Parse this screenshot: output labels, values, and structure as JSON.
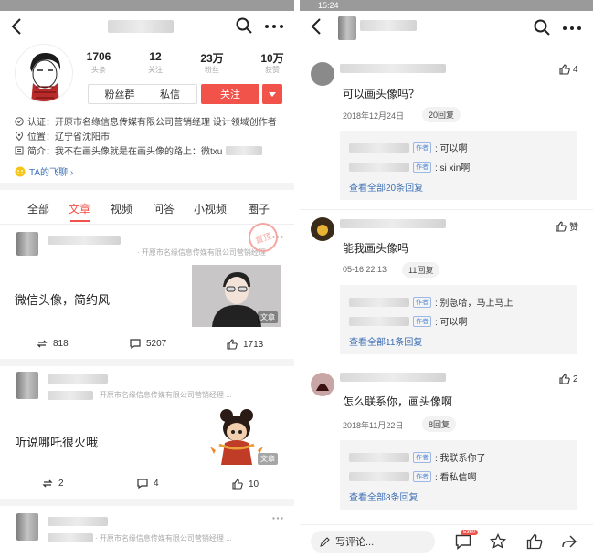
{
  "left": {
    "stats": [
      {
        "value": "1706",
        "label": "头条"
      },
      {
        "value": "12",
        "label": "关注"
      },
      {
        "value": "23万",
        "label": "粉丝"
      },
      {
        "value": "10万",
        "label": "获赞"
      }
    ],
    "buttons": {
      "fans_group": "粉丝群",
      "message": "私信",
      "follow": "关注"
    },
    "info": {
      "certified": "认证：开原市名缘信息传媒有限公司营销经理 设计领域创作者",
      "location": "位置：辽宁省沈阳市",
      "bio": "简介：我不在画头像就是在画头像的路上：微txu"
    },
    "feiliao": "TA的飞聊 ›",
    "tabs": [
      "全部",
      "文章",
      "视频",
      "问答",
      "小视频",
      "圈子"
    ],
    "posts": [
      {
        "subtitle": "· 开原市名缘信息传媒有限公司营销经理",
        "title": "微信头像，简约风",
        "shares": "818",
        "comments": "5207",
        "likes": "1713",
        "thumb_badge": "文章"
      },
      {
        "subtitle": "· 开原市名缘信息传媒有限公司营销经理 ...",
        "title": "听说哪吒很火哦",
        "shares": "2",
        "comments": "4",
        "likes": "10",
        "thumb_badge": "文章"
      },
      {
        "subtitle": "· 开原市名缘信息传媒有限公司营销经理 ..."
      }
    ],
    "stamp": "置顶"
  },
  "right": {
    "status_time": "15:24",
    "comments": [
      {
        "text": "可以画头像吗？",
        "date": "2018年12月24日",
        "replies_pill": "20回复",
        "likes": "4",
        "replies": [
          {
            "tag": "作者",
            "text": ": 可以啊"
          },
          {
            "tag": "作者",
            "text": ": si xin啊"
          }
        ],
        "see_all": "查看全部20条回复"
      },
      {
        "text": "能我画头像吗",
        "date": "05-16 22:13",
        "replies_pill": "11回复",
        "likes": "赞",
        "replies": [
          {
            "tag": "作者",
            "text": ": 别急哈，马上马上"
          },
          {
            "tag": "作者",
            "text": ": 可以啊"
          }
        ],
        "see_all": "查看全部11条回复"
      },
      {
        "text": "怎么联系你，画头像啊",
        "date": "2018年11月22日",
        "replies_pill": "8回复",
        "likes": "2",
        "replies": [
          {
            "tag": "作者",
            "text": ": 我联系你了"
          },
          {
            "tag": "作者",
            "text": ": 看私信啊"
          }
        ],
        "see_all": "查看全部8条回复"
      }
    ],
    "bottom": {
      "input": "写评论...",
      "badge": "5360"
    }
  },
  "colors": {
    "accent": "#f1524a",
    "link": "#3d6fb5"
  }
}
